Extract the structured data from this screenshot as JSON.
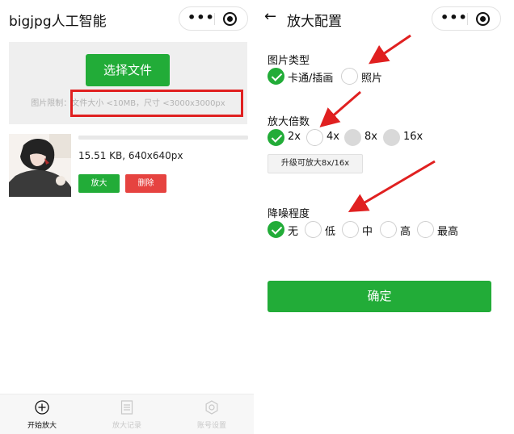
{
  "left": {
    "title": "bigjpg人工智能",
    "choose_label": "选择文件",
    "limit_text": "图片限制：文件大小 <10MB，尺寸 <3000x3000px",
    "file": {
      "info": "15.51 KB, 640x640px",
      "progress": 1.0,
      "enlarge_label": "放大",
      "delete_label": "删除"
    },
    "tabs": [
      {
        "label": "开始放大",
        "icon": "plus-circle-icon",
        "active": true
      },
      {
        "label": "放大记录",
        "icon": "list-icon",
        "active": false
      },
      {
        "label": "账号设置",
        "icon": "gear-icon",
        "active": false
      }
    ]
  },
  "right": {
    "title": "放大配置",
    "image_type": {
      "label": "图片类型",
      "options": [
        {
          "label": "卡通/插画",
          "checked": true
        },
        {
          "label": "照片",
          "checked": false
        }
      ]
    },
    "scale": {
      "label": "放大倍数",
      "options": [
        {
          "label": "2x",
          "checked": true
        },
        {
          "label": "4x",
          "checked": false
        },
        {
          "label": "8x",
          "checked": false,
          "disabled": true
        },
        {
          "label": "16x",
          "checked": false,
          "disabled": true
        }
      ],
      "upgrade_label": "升级可放大8x/16x"
    },
    "denoise": {
      "label": "降噪程度",
      "options": [
        {
          "label": "无",
          "checked": true
        },
        {
          "label": "低",
          "checked": false
        },
        {
          "label": "中",
          "checked": false
        },
        {
          "label": "高",
          "checked": false
        },
        {
          "label": "最高",
          "checked": false
        }
      ]
    },
    "confirm_label": "确定"
  },
  "colors": {
    "accent": "#22ac38",
    "danger": "#e64340",
    "annotation": "#e02020"
  }
}
